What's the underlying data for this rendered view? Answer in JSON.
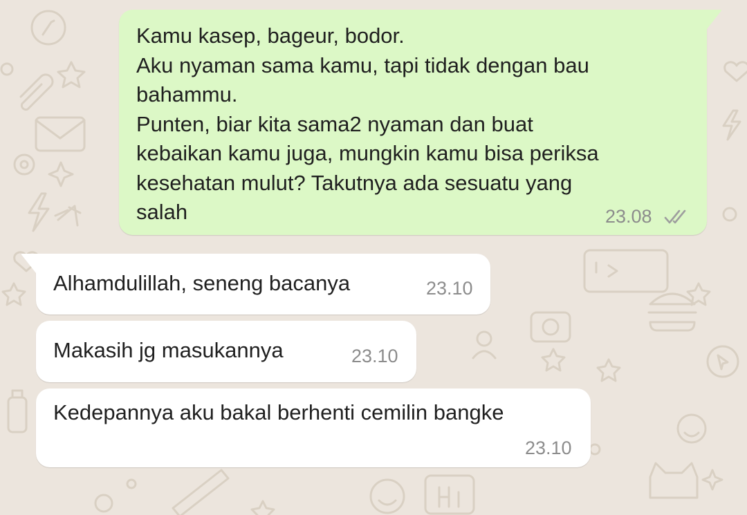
{
  "chat": {
    "messages": [
      {
        "direction": "outgoing",
        "lines": [
          "Kamu kasep, bageur, bodor.",
          "Aku nyaman sama kamu, tapi tidak dengan bau",
          "bahammu.",
          "Punten, biar kita sama2 nyaman dan buat",
          "kebaikan kamu juga, mungkin kamu bisa periksa",
          "kesehatan mulut? Takutnya ada sesuatu yang",
          "salah"
        ],
        "time": "23.08",
        "status": "read",
        "status_icon": "double-check-icon"
      },
      {
        "direction": "incoming",
        "text": "Alhamdulillah, seneng bacanya",
        "time": "23.10"
      },
      {
        "direction": "incoming",
        "text": "Makasih jg masukannya",
        "time": "23.10"
      },
      {
        "direction": "incoming",
        "text": "Kedepannya aku bakal berhenti cemilin bangke",
        "time": "23.10"
      }
    ],
    "colors": {
      "wallpaper": "#ECE5DD",
      "outgoing_bubble": "#DCF8C6",
      "incoming_bubble": "#FFFFFF",
      "timestamp": "#8C8C8C",
      "ticks": "#9E9E9E"
    }
  }
}
